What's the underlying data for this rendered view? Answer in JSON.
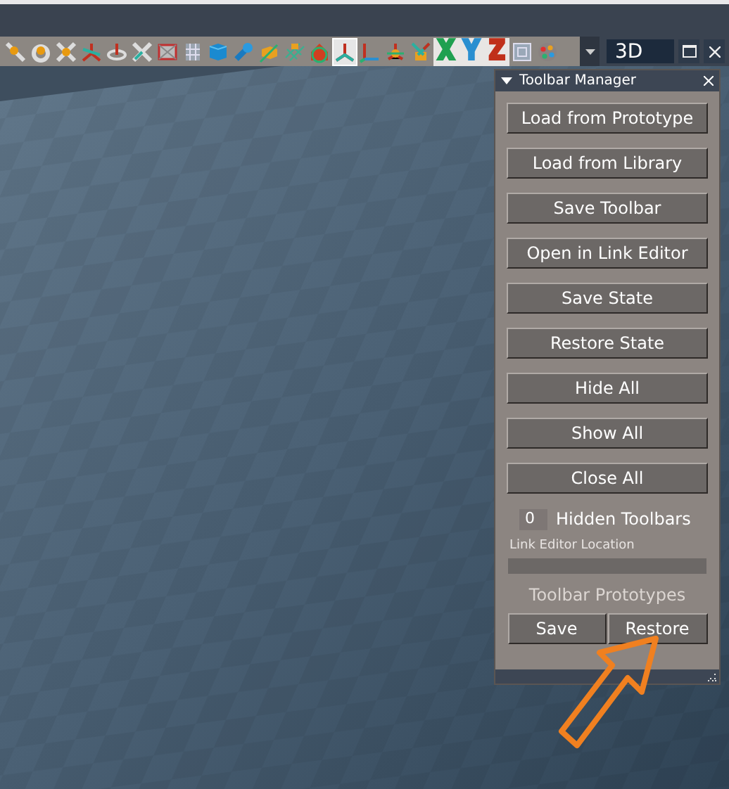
{
  "toolbar": {
    "items": [
      {
        "kind": "icon",
        "selected": false
      },
      {
        "kind": "icon",
        "selected": false
      },
      {
        "kind": "icon",
        "selected": false
      },
      {
        "kind": "icon",
        "selected": false
      },
      {
        "kind": "icon",
        "selected": false
      },
      {
        "kind": "icon",
        "selected": false
      },
      {
        "kind": "icon",
        "selected": false
      },
      {
        "kind": "icon",
        "selected": false
      },
      {
        "kind": "icon",
        "selected": false
      },
      {
        "kind": "icon",
        "selected": false
      },
      {
        "kind": "icon",
        "selected": false
      },
      {
        "kind": "icon",
        "selected": false
      },
      {
        "kind": "icon",
        "selected": false
      },
      {
        "kind": "icon",
        "selected": true
      },
      {
        "kind": "icon",
        "selected": false
      },
      {
        "kind": "icon",
        "selected": false
      },
      {
        "kind": "icon",
        "selected": false
      },
      {
        "kind": "letter",
        "text": "X",
        "color": "#1fa050",
        "selected": false
      },
      {
        "kind": "letter",
        "text": "Y",
        "color": "#2a8fd0",
        "selected": false
      },
      {
        "kind": "letter",
        "text": "Z",
        "color": "#c0301a",
        "selected": false
      },
      {
        "kind": "icon",
        "selected": false
      },
      {
        "kind": "icon",
        "selected": false
      }
    ]
  },
  "viewport": {
    "label": "3D"
  },
  "panel": {
    "title": "Toolbar Manager",
    "buttons": [
      "Load from Prototype",
      "Load from Library",
      "Save Toolbar",
      "Open in Link Editor",
      "Save State",
      "Restore State",
      "Hide All",
      "Show All",
      "Close All"
    ],
    "hidden_count": "0",
    "hidden_label": "Hidden Toolbars",
    "location_label": "Link Editor Location",
    "prototypes_label": "Toolbar Prototypes",
    "prototype_buttons": [
      "Save",
      "Restore"
    ]
  }
}
